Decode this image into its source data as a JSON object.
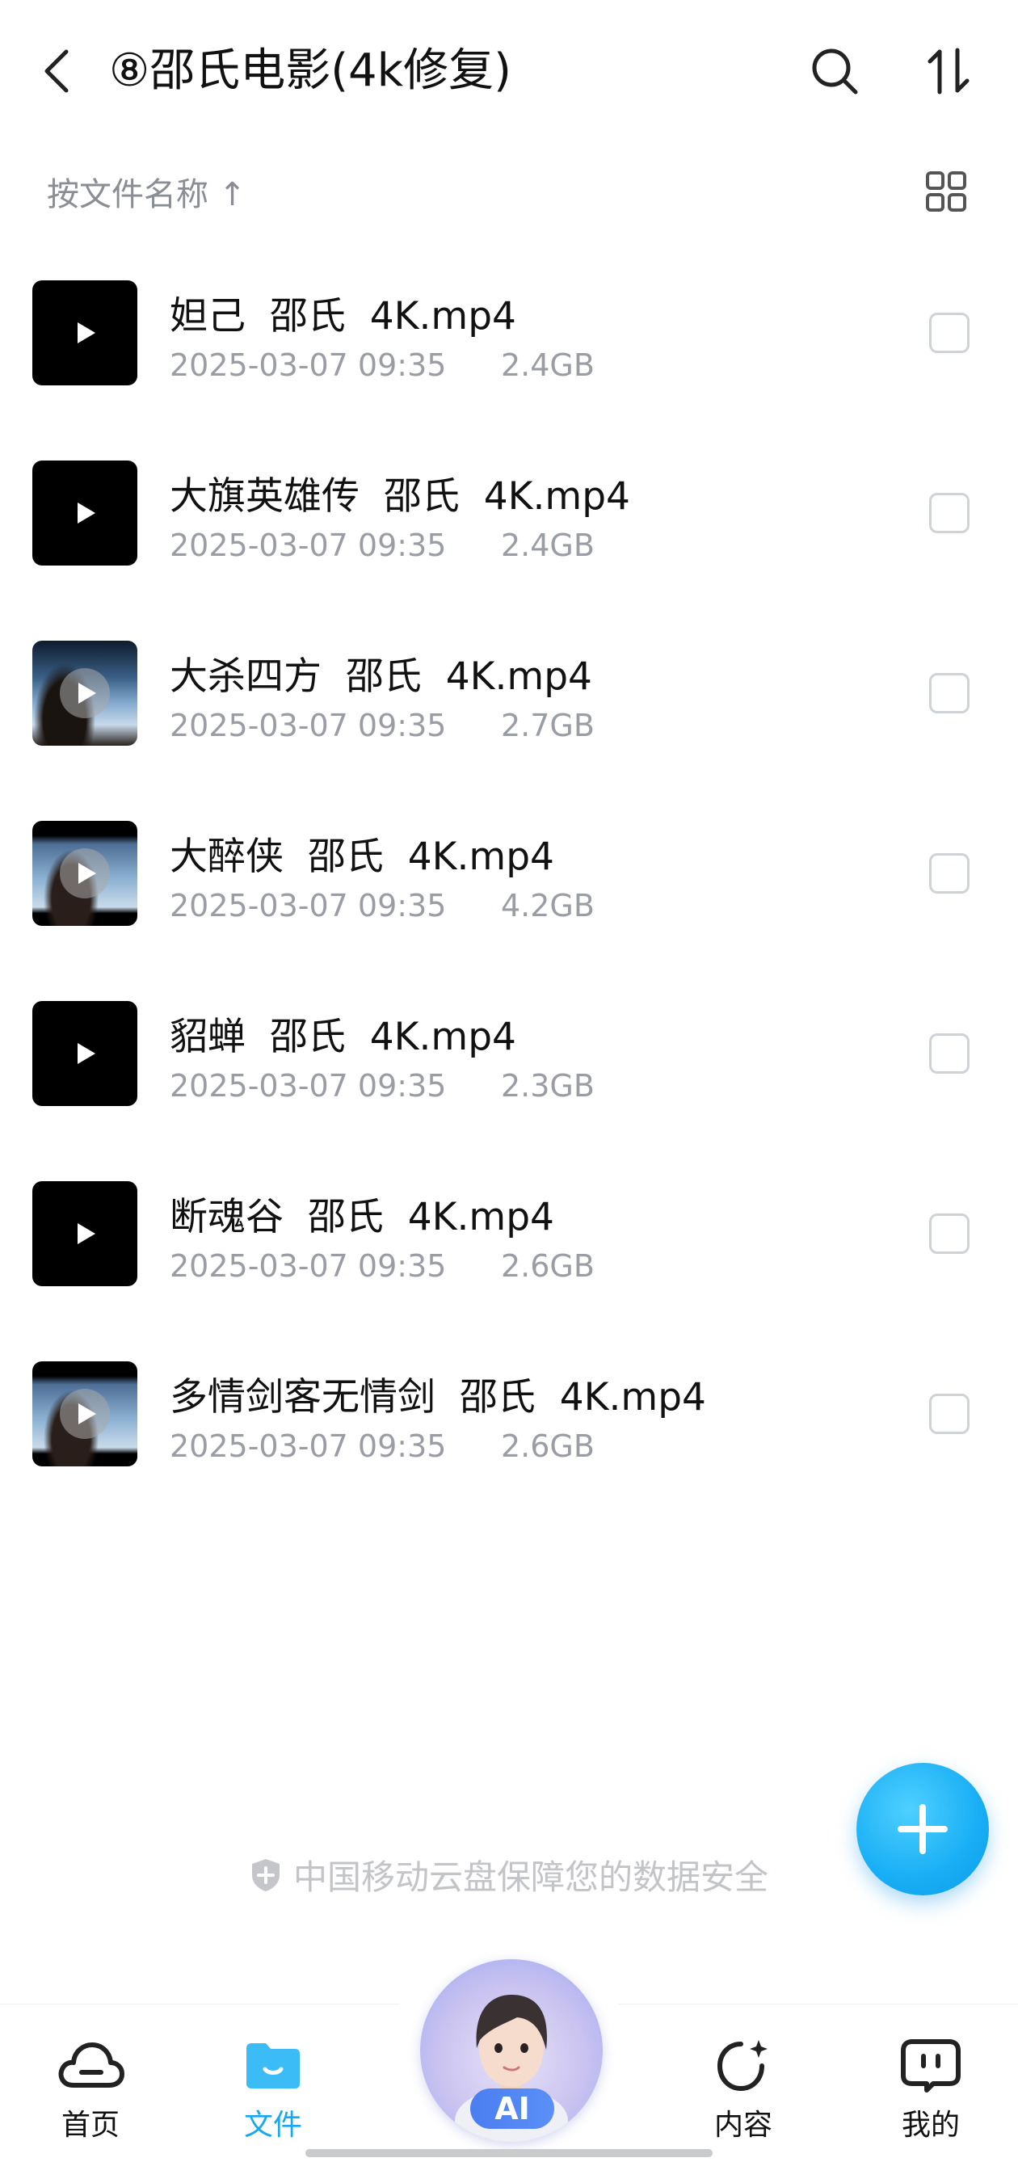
{
  "header": {
    "title": "⑧邵氏电影(4k修复)",
    "back_icon": "chevron-left-icon",
    "search_icon": "search-icon",
    "sort_icon": "sort-arrows-icon"
  },
  "sort_bar": {
    "label": "按文件名称 ↑",
    "view_icon": "grid-view-icon"
  },
  "files": [
    {
      "name": "妲己  邵氏  4K.mp4",
      "date": "2025-03-07 09:35",
      "size": "2.4GB",
      "thumb": "black"
    },
    {
      "name": "大旗英雄传  邵氏  4K.mp4",
      "date": "2025-03-07 09:35",
      "size": "2.4GB",
      "thumb": "black"
    },
    {
      "name": "大杀四方  邵氏  4K.mp4",
      "date": "2025-03-07 09:35",
      "size": "2.7GB",
      "thumb": "photo"
    },
    {
      "name": "大醉侠  邵氏  4K.mp4",
      "date": "2025-03-07 09:35",
      "size": "4.2GB",
      "thumb": "photo"
    },
    {
      "name": "貂蝉  邵氏  4K.mp4",
      "date": "2025-03-07 09:35",
      "size": "2.3GB",
      "thumb": "black"
    },
    {
      "name": "断魂谷  邵氏  4K.mp4",
      "date": "2025-03-07 09:35",
      "size": "2.6GB",
      "thumb": "black"
    },
    {
      "name": "多情剑客无情剑  邵氏  4K.mp4",
      "date": "2025-03-07 09:35",
      "size": "2.6GB",
      "thumb": "photo"
    }
  ],
  "notice": {
    "text": "中国移动云盘保障您的数据安全",
    "icon": "shield-plus-icon"
  },
  "bottom_nav": {
    "home": "首页",
    "files": "文件",
    "ai": "AI",
    "content": "内容",
    "mine": "我的",
    "active_color": "#1aa7f2"
  },
  "colors": {
    "accent": "#1aa7f2",
    "text_primary": "#111111",
    "text_secondary": "#9a9da3"
  }
}
